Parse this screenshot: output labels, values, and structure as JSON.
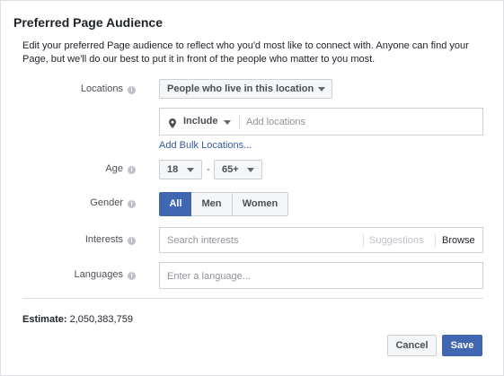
{
  "dialog": {
    "title": "Preferred Page Audience",
    "description": "Edit your preferred Page audience to reflect who you'd most like to connect with. Anyone can find your Page, but we'll do our best to put it in front of the people who matter to you most."
  },
  "locations": {
    "label": "Locations",
    "scope_value": "People who live in this location",
    "include_value": "Include",
    "placeholder": "Add locations",
    "bulk_link": "Add Bulk Locations..."
  },
  "age": {
    "label": "Age",
    "min": "18",
    "separator": "-",
    "max": "65+"
  },
  "gender": {
    "label": "Gender",
    "options": [
      "All",
      "Men",
      "Women"
    ],
    "selected": "All"
  },
  "interests": {
    "label": "Interests",
    "placeholder": "Search interests",
    "suggestions": "Suggestions",
    "browse": "Browse"
  },
  "languages": {
    "label": "Languages",
    "placeholder": "Enter a language..."
  },
  "estimate": {
    "label": "Estimate:",
    "value": "2,050,383,759"
  },
  "buttons": {
    "cancel": "Cancel",
    "save": "Save"
  },
  "colors": {
    "accent": "#4267b2",
    "link": "#365899"
  }
}
